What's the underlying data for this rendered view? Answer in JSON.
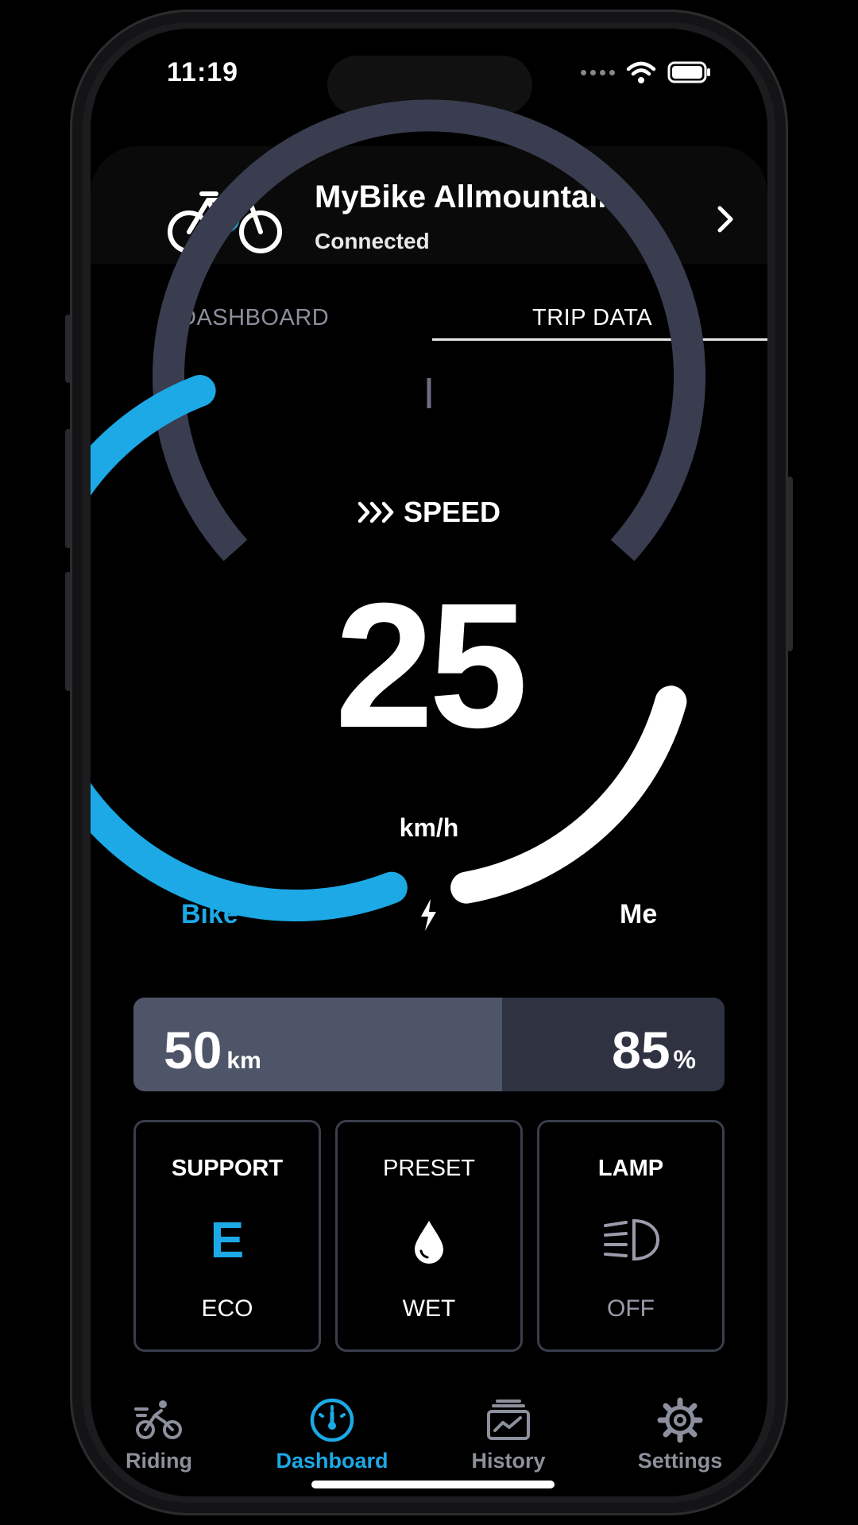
{
  "status_bar": {
    "time": "11:19"
  },
  "header": {
    "bike_name": "MyBike Allmountain",
    "connection_status": "Connected"
  },
  "tabs": [
    {
      "label": "DASHBOARD",
      "active": false
    },
    {
      "label": "TRIP DATA",
      "active": true
    }
  ],
  "gauge": {
    "label": "SPEED",
    "speed_value": "25",
    "unit": "km/h",
    "left_label": "Bike",
    "right_label": "Me",
    "colors": {
      "bike": "#1ca9e6",
      "me": "#ffffff",
      "track": "#3a3d4f"
    }
  },
  "range": {
    "distance_value": "50",
    "distance_unit": "km",
    "battery_value": "85",
    "battery_unit": "%"
  },
  "tiles": [
    {
      "title": "SUPPORT",
      "symbol": "E",
      "value": "ECO"
    },
    {
      "title": "PRESET",
      "icon": "drop-icon",
      "value": "WET"
    },
    {
      "title": "LAMP",
      "icon": "headlight-icon",
      "value": "OFF"
    }
  ],
  "bottom_nav": [
    {
      "label": "Riding",
      "icon": "riding-icon",
      "active": false
    },
    {
      "label": "Dashboard",
      "icon": "speedometer-icon",
      "active": true
    },
    {
      "label": "History",
      "icon": "history-icon",
      "active": false
    },
    {
      "label": "Settings",
      "icon": "gear-icon",
      "active": false
    }
  ]
}
